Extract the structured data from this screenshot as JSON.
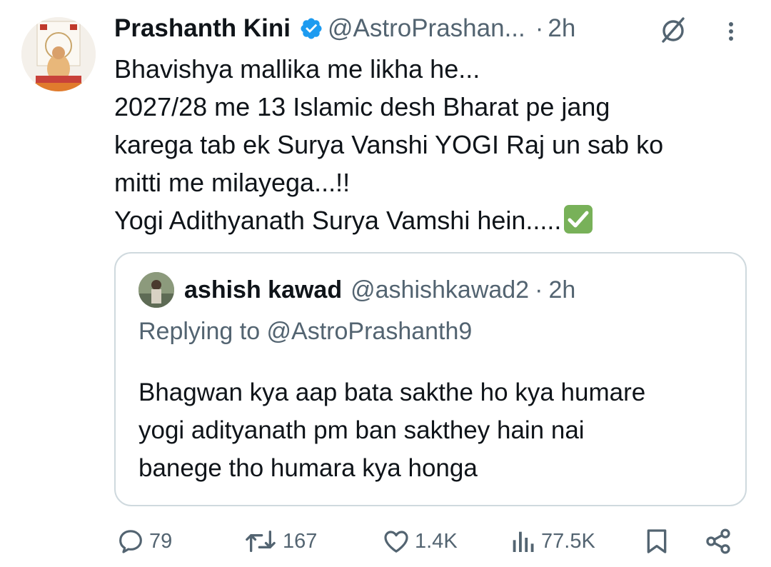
{
  "tweet": {
    "author_name": "Prashanth Kini",
    "handle": "@AstroPrashan...",
    "separator": "·",
    "time": "2h",
    "lines": [
      "Bhavishya mallika me likha he...",
      "2027/28 me 13 Islamic desh Bharat pe jang",
      "karega tab ek Surya Vanshi YOGI Raj un sab ko",
      "mitti me milayega...!!",
      "Yogi Adithyanath Surya Vamshi hein....."
    ],
    "trailing_emoji": "white-heavy-check-mark"
  },
  "quoted": {
    "author_name": "ashish kawad",
    "handle": "@ashishkawad2",
    "separator": "·",
    "time": "2h",
    "replying_to": "Replying to @AstroPrashanth9",
    "lines": [
      "Bhagwan kya aap bata sakthe ho kya humare",
      "yogi adityanath pm ban sakthey hain nai",
      "banege tho humara kya honga"
    ]
  },
  "actions": {
    "replies": "79",
    "reposts": "167",
    "likes": "1.4K",
    "views": "77.5K"
  },
  "colors": {
    "verified": "#1d9bf0",
    "secondary_text": "#536471",
    "border": "#cfd9de",
    "check_emoji": "#78b159"
  }
}
